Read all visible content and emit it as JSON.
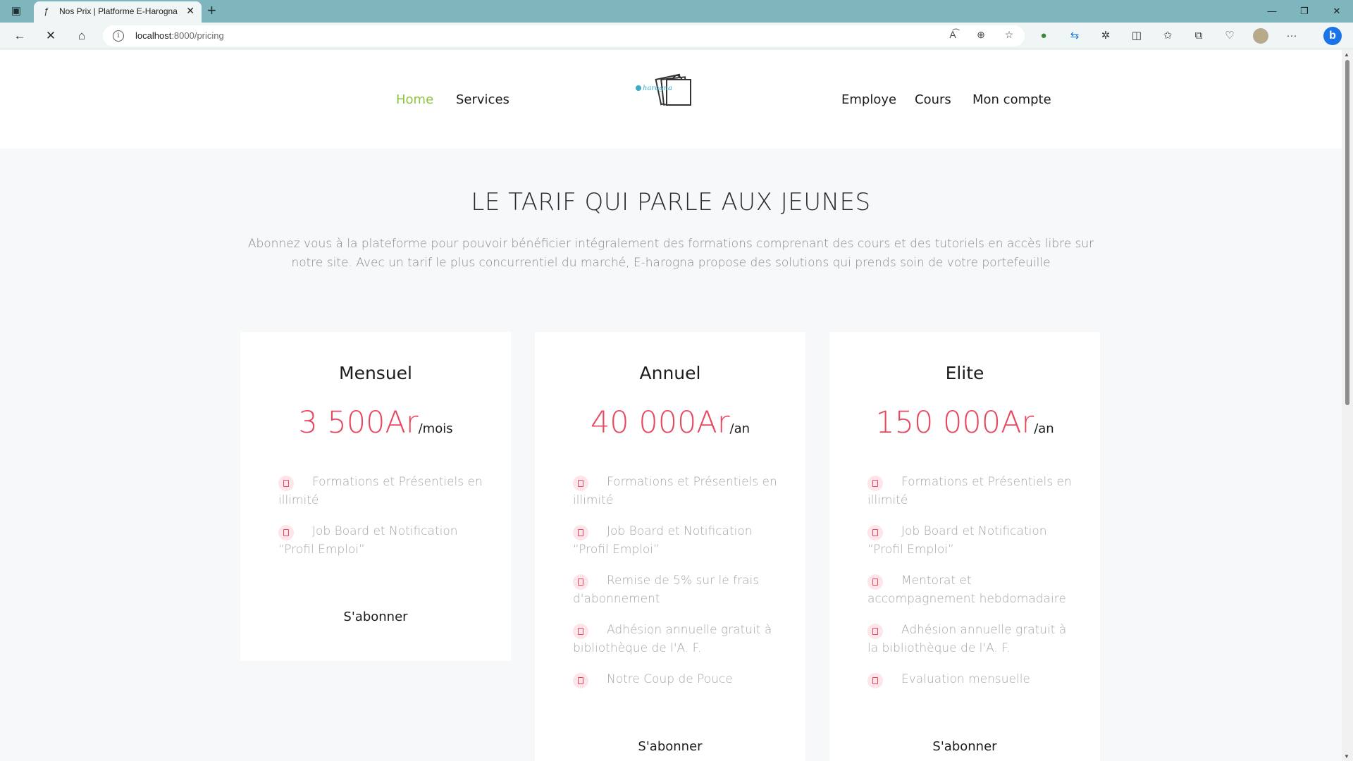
{
  "browser": {
    "tab_title": "Nos Prix | Platforme E-Harogna",
    "url_host": "localhost",
    "url_rest": ":8000/pricing"
  },
  "nav": {
    "home": "Home",
    "services": "Services",
    "employe": "Employe",
    "cours": "Cours",
    "mon_compte": "Mon compte",
    "logo_text": "e-harogna"
  },
  "hero": {
    "title": "LE TARIF QUI PARLE AUX JEUNES",
    "description": "Abonnez vous à la plateforme pour pouvoir bénéficier intégralement des formations comprenant des cours et des tutoriels en accès libre sur notre site. Avec un tarif le plus concurrentiel du marché, E-harogna propose des solutions qui prends soin de votre portefeuille"
  },
  "plans": [
    {
      "name": "Mensuel",
      "price": "3 500Ar",
      "unit": "/mois",
      "features": [
        "Formations et Présentiels en illimité",
        "Job Board et Notification “Profil Emploi”"
      ],
      "cta": "S'abonner"
    },
    {
      "name": "Annuel",
      "price": "40 000Ar",
      "unit": "/an",
      "features": [
        "Formations et Présentiels en illimité",
        "Job Board et Notification “Profil Emploi”",
        "Remise de 5% sur le frais d'abonnement",
        "Adhésion annuelle gratuit à bibliothèque de l'A. F.",
        "Notre Coup de Pouce"
      ],
      "cta": "S'abonner"
    },
    {
      "name": "Elite",
      "price": "150 000Ar",
      "unit": "/an",
      "features": [
        "Formations et Présentiels en illimité",
        "Job Board et Notification “Profil Emploi”",
        "Mentorat et accompagnement hebdomadaire",
        "Adhésion annuelle gratuit à la bibliothèque de l'A. F.",
        "Evaluation mensuelle"
      ],
      "cta": "S'abonner"
    }
  ],
  "colors": {
    "accent_price": "#e8475f",
    "nav_active": "#8cc63f",
    "tabbar": "#7fb6be"
  }
}
